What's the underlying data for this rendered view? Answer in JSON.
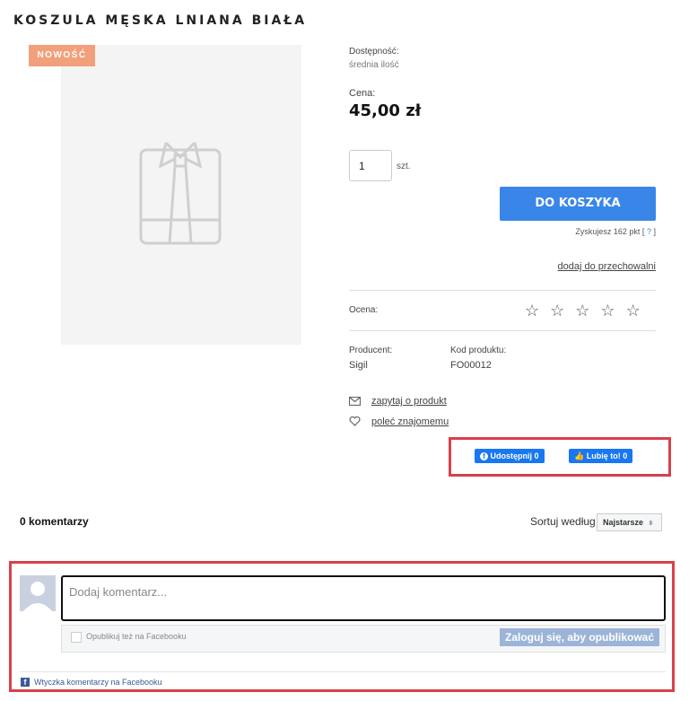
{
  "product": {
    "title": "KOSZULA MĘSKA LNIANA BIAŁA",
    "badge": "NOWOŚĆ",
    "availability_label": "Dostępność:",
    "availability_value": "średnia ilość",
    "price_label": "Cena:",
    "price_value": "45,00 zł",
    "quantity_value": "1",
    "quantity_unit": "szt.",
    "add_to_cart": "DO KOSZYKA",
    "points_text": "Zyskujesz 162 pkt [",
    "points_help": "?",
    "points_close": "]",
    "store_link": "dodaj do przechowalni",
    "rating_label": "Ocena:",
    "rating_value": 0,
    "rating_max": 5,
    "producer_label": "Producent:",
    "producer_value": "Sigil",
    "code_label": "Kod produktu:",
    "code_value": "FO00012",
    "ask_link": "zapytaj o produkt",
    "recommend_link": "poleć znajomemu"
  },
  "social": {
    "share_label": "Udostępnij 0",
    "like_label": "Lubię to! 0"
  },
  "comments": {
    "count_label": "0 komentarzy",
    "sort_label": "Sortuj według",
    "sort_value": "Najstarsze",
    "placeholder": "Dodaj komentarz...",
    "publish_fb_label": "Opublikuj też na Facebooku",
    "login_button": "Zaloguj się, aby opublikować",
    "plugin_label": "Wtyczka komentarzy na Facebooku"
  },
  "icons": {
    "product_placeholder": "shirt-icon",
    "mail": "mail-icon",
    "heart": "heart-icon",
    "star": "star-icon",
    "facebook": "facebook-icon",
    "thumb": "thumbs-up-icon"
  },
  "colors": {
    "accent": "#3a86e8",
    "badge": "#f2a07b",
    "highlight": "#d9404a",
    "facebook": "#1877f2"
  }
}
